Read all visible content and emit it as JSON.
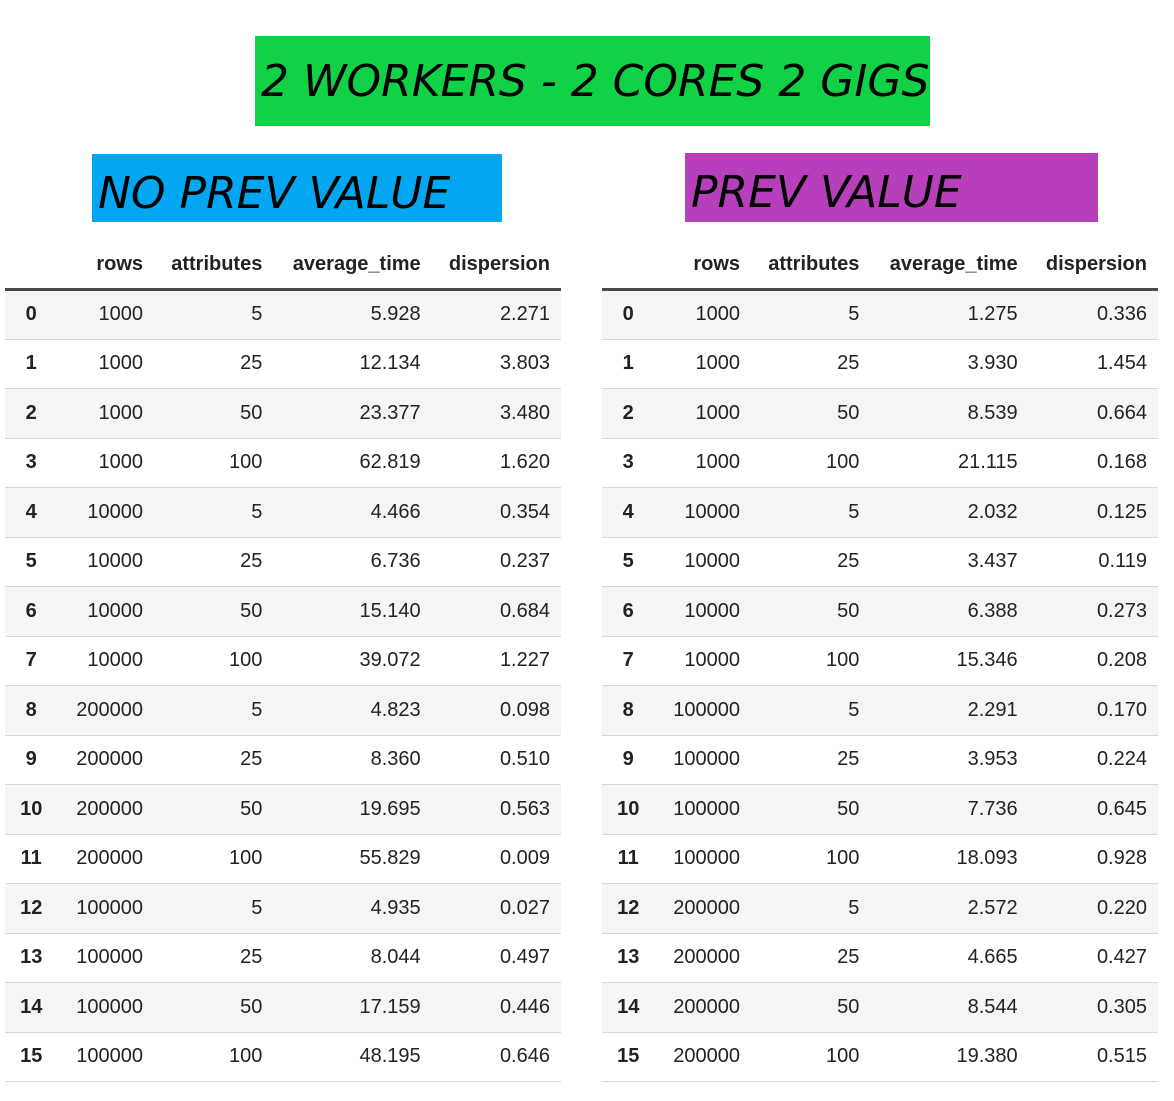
{
  "title": "2 WORKERS - 2 CORES 2 GIGS",
  "colors": {
    "title_banner": "#11d146",
    "left_banner": "#03a6f0",
    "right_banner": "#b83fbb"
  },
  "columns": [
    "",
    "rows",
    "attributes",
    "average_time",
    "dispersion"
  ],
  "left": {
    "heading": "NO PREV VALUE",
    "rows": [
      [
        "0",
        "1000",
        "5",
        "5.928",
        "2.271"
      ],
      [
        "1",
        "1000",
        "25",
        "12.134",
        "3.803"
      ],
      [
        "2",
        "1000",
        "50",
        "23.377",
        "3.480"
      ],
      [
        "3",
        "1000",
        "100",
        "62.819",
        "1.620"
      ],
      [
        "4",
        "10000",
        "5",
        "4.466",
        "0.354"
      ],
      [
        "5",
        "10000",
        "25",
        "6.736",
        "0.237"
      ],
      [
        "6",
        "10000",
        "50",
        "15.140",
        "0.684"
      ],
      [
        "7",
        "10000",
        "100",
        "39.072",
        "1.227"
      ],
      [
        "8",
        "200000",
        "5",
        "4.823",
        "0.098"
      ],
      [
        "9",
        "200000",
        "25",
        "8.360",
        "0.510"
      ],
      [
        "10",
        "200000",
        "50",
        "19.695",
        "0.563"
      ],
      [
        "11",
        "200000",
        "100",
        "55.829",
        "0.009"
      ],
      [
        "12",
        "100000",
        "5",
        "4.935",
        "0.027"
      ],
      [
        "13",
        "100000",
        "25",
        "8.044",
        "0.497"
      ],
      [
        "14",
        "100000",
        "50",
        "17.159",
        "0.446"
      ],
      [
        "15",
        "100000",
        "100",
        "48.195",
        "0.646"
      ]
    ]
  },
  "right": {
    "heading": "PREV VALUE",
    "rows": [
      [
        "0",
        "1000",
        "5",
        "1.275",
        "0.336"
      ],
      [
        "1",
        "1000",
        "25",
        "3.930",
        "1.454"
      ],
      [
        "2",
        "1000",
        "50",
        "8.539",
        "0.664"
      ],
      [
        "3",
        "1000",
        "100",
        "21.115",
        "0.168"
      ],
      [
        "4",
        "10000",
        "5",
        "2.032",
        "0.125"
      ],
      [
        "5",
        "10000",
        "25",
        "3.437",
        "0.119"
      ],
      [
        "6",
        "10000",
        "50",
        "6.388",
        "0.273"
      ],
      [
        "7",
        "10000",
        "100",
        "15.346",
        "0.208"
      ],
      [
        "8",
        "100000",
        "5",
        "2.291",
        "0.170"
      ],
      [
        "9",
        "100000",
        "25",
        "3.953",
        "0.224"
      ],
      [
        "10",
        "100000",
        "50",
        "7.736",
        "0.645"
      ],
      [
        "11",
        "100000",
        "100",
        "18.093",
        "0.928"
      ],
      [
        "12",
        "200000",
        "5",
        "2.572",
        "0.220"
      ],
      [
        "13",
        "200000",
        "25",
        "4.665",
        "0.427"
      ],
      [
        "14",
        "200000",
        "50",
        "8.544",
        "0.305"
      ],
      [
        "15",
        "200000",
        "100",
        "19.380",
        "0.515"
      ]
    ]
  }
}
